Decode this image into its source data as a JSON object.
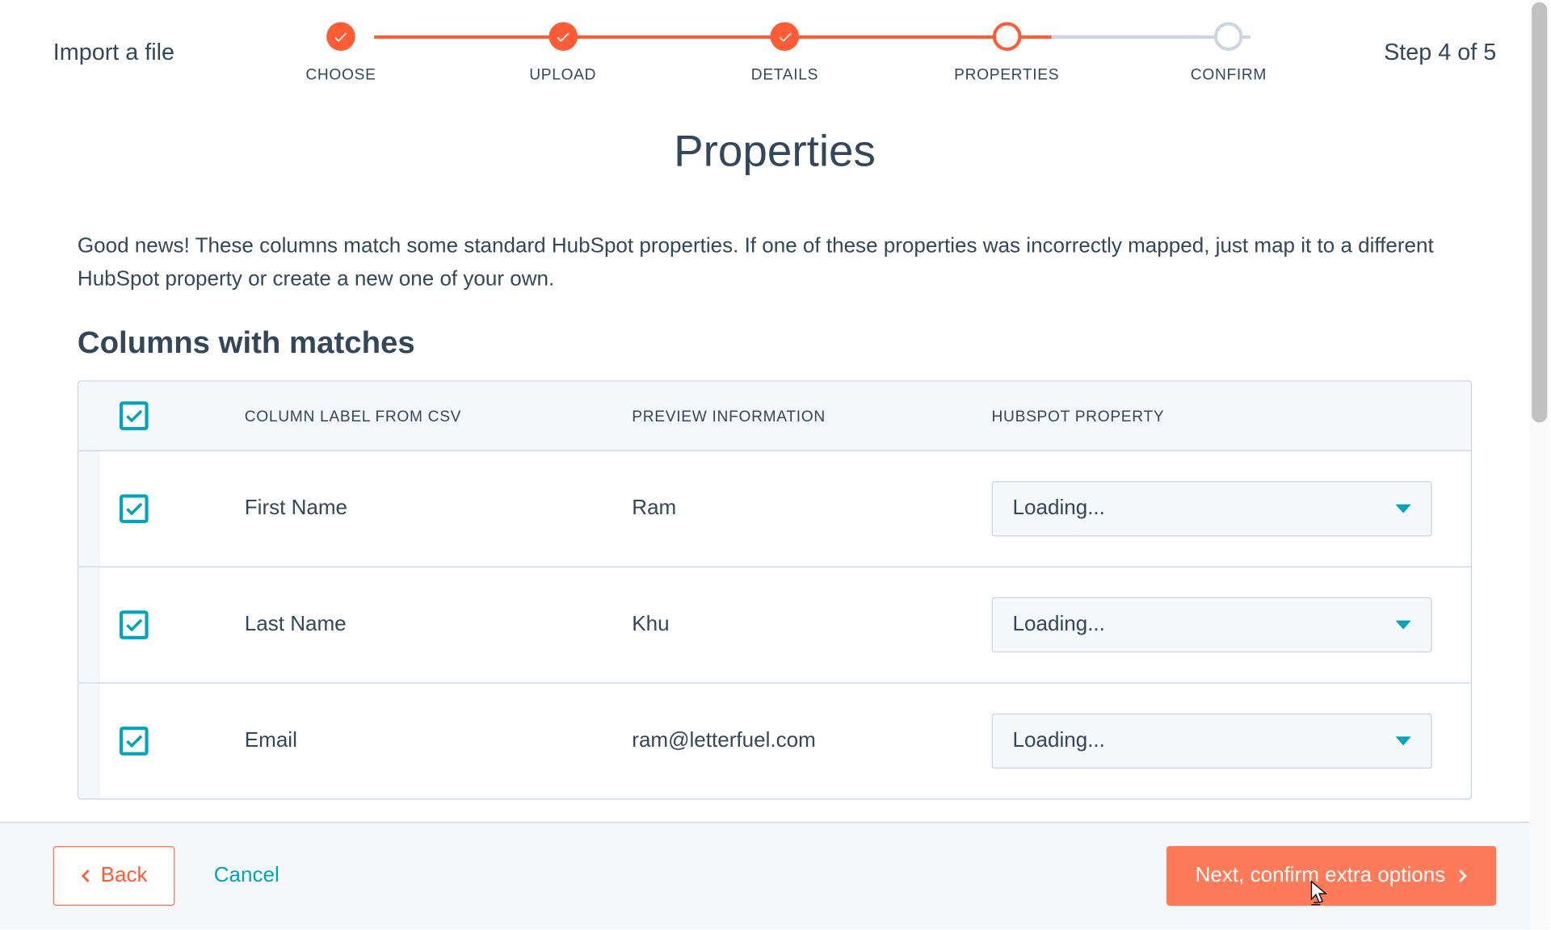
{
  "header": {
    "title": "Import a file",
    "step_count": "Step 4 of 5"
  },
  "stepper": {
    "steps": [
      {
        "label": "CHOOSE",
        "state": "done"
      },
      {
        "label": "UPLOAD",
        "state": "done"
      },
      {
        "label": "DETAILS",
        "state": "done"
      },
      {
        "label": "PROPERTIES",
        "state": "current"
      },
      {
        "label": "CONFIRM",
        "state": "pending"
      }
    ]
  },
  "main": {
    "title": "Properties",
    "description": "Good news! These columns match some standard HubSpot properties. If one of these properties was incorrectly mapped, just map it to a different HubSpot property or create a new one of your own.",
    "section_title": "Columns with matches",
    "table": {
      "headers": {
        "column_label": "COLUMN LABEL FROM CSV",
        "preview": "PREVIEW INFORMATION",
        "property": "HUBSPOT PROPERTY"
      },
      "rows": [
        {
          "checked": true,
          "label": "First Name",
          "preview": "Ram",
          "property": "Loading..."
        },
        {
          "checked": true,
          "label": "Last Name",
          "preview": "Khu",
          "property": "Loading..."
        },
        {
          "checked": true,
          "label": "Email",
          "preview": "ram@letterfuel.com",
          "property": "Loading..."
        }
      ]
    }
  },
  "footer": {
    "back": "Back",
    "cancel": "Cancel",
    "next": "Next, confirm extra options"
  }
}
